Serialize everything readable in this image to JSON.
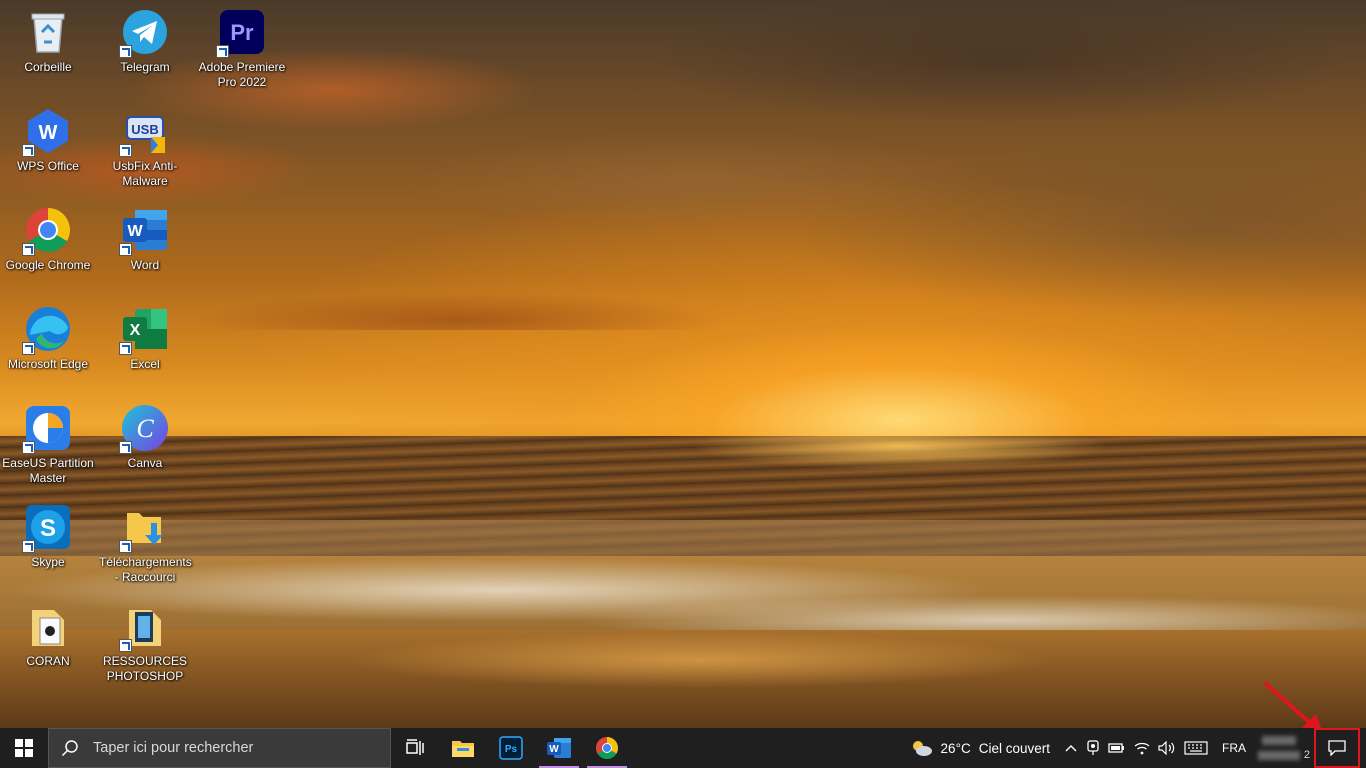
{
  "desktop": {
    "icons": [
      {
        "id": "recycle",
        "label": "Corbeille",
        "icon": "recycle-bin-icon"
      },
      {
        "id": "telegram",
        "label": "Telegram",
        "icon": "telegram-icon"
      },
      {
        "id": "premiere",
        "label": "Adobe Premiere Pro 2022",
        "icon": "premiere-pro-icon",
        "glyph": "Pr"
      },
      {
        "id": "wps",
        "label": "WPS Office",
        "icon": "wps-office-icon",
        "glyph": "W"
      },
      {
        "id": "usbfix",
        "label": "UsbFix Anti-Malware",
        "icon": "usbfix-icon",
        "glyph": "USB"
      },
      {
        "id": "chrome",
        "label": "Google Chrome",
        "icon": "chrome-icon"
      },
      {
        "id": "word",
        "label": "Word",
        "icon": "word-icon",
        "glyph": "W"
      },
      {
        "id": "edge",
        "label": "Microsoft Edge",
        "icon": "edge-icon"
      },
      {
        "id": "excel",
        "label": "Excel",
        "icon": "excel-icon",
        "glyph": "X"
      },
      {
        "id": "easeus",
        "label": "EaseUS Partition Master",
        "icon": "easeus-icon"
      },
      {
        "id": "canva",
        "label": "Canva",
        "icon": "canva-icon",
        "glyph": "C"
      },
      {
        "id": "skype",
        "label": "Skype",
        "icon": "skype-icon",
        "glyph": "S"
      },
      {
        "id": "downloads",
        "label": "Téléchargements - Raccourci",
        "icon": "downloads-folder-icon"
      },
      {
        "id": "coran",
        "label": "CORAN",
        "icon": "coran-icon"
      },
      {
        "id": "photoshop_res",
        "label": "RESSOURCES PHOTOSHOP",
        "icon": "ressources-photoshop-icon"
      }
    ]
  },
  "taskbar": {
    "search_placeholder": "Taper ici pour rechercher",
    "apps": [
      {
        "id": "taskview",
        "icon": "task-view-icon"
      },
      {
        "id": "explorer",
        "icon": "file-explorer-icon"
      },
      {
        "id": "photoshop",
        "icon": "photoshop-icon",
        "glyph": "Ps"
      },
      {
        "id": "word",
        "icon": "word-icon",
        "glyph": "W"
      },
      {
        "id": "chrome",
        "icon": "chrome-icon"
      }
    ],
    "weather": {
      "temp": "26°C",
      "condition": "Ciel couvert"
    },
    "language": "FRA",
    "clock_fragment": "2",
    "notification_icon": "action-center-icon"
  },
  "colors": {
    "taskbar_bg": "#1f1f1f",
    "active_indicator": "#c38ee6",
    "highlight_red": "#e0161f"
  }
}
